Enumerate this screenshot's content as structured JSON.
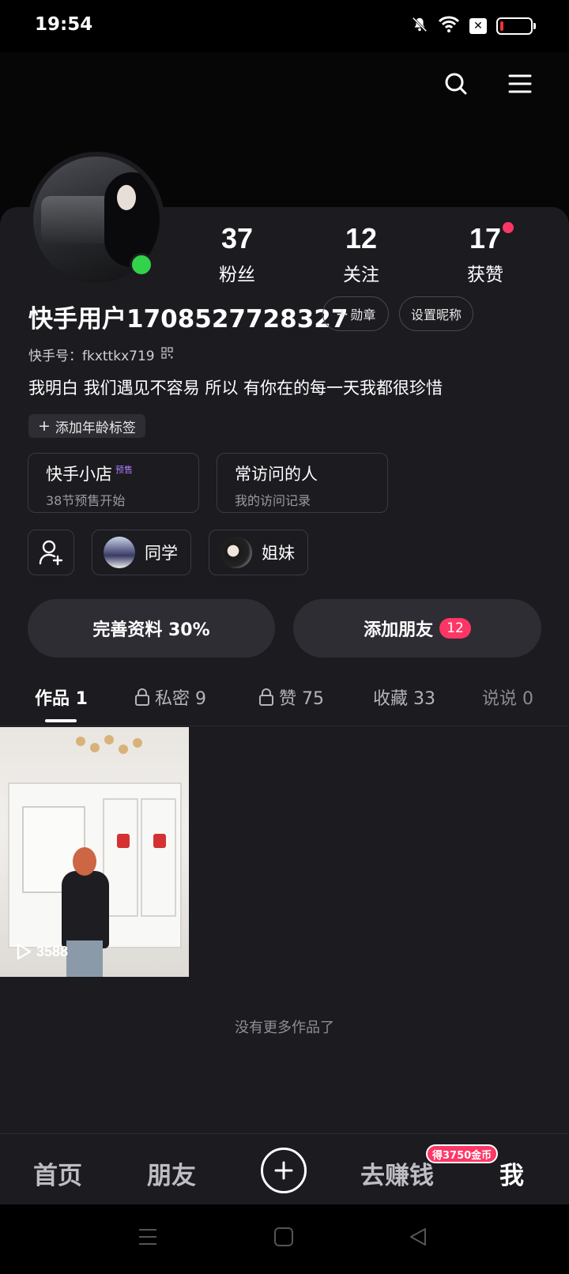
{
  "status_bar": {
    "time": "19:54",
    "icons": [
      "bell-off-icon",
      "wifi-icon",
      "x-box-icon",
      "battery-low-icon"
    ]
  },
  "header": {
    "actions": [
      "search-icon",
      "menu-icon"
    ]
  },
  "profile": {
    "username": "快手用户1708527728327",
    "kuaishou_id": "快手号：fkxttkx719",
    "bio": "我明白 我们遇见不容易 所以 有你在的每一天我都很珍惜",
    "age_tag": "添加年龄标签",
    "badge_button": "勋章",
    "nickname_button": "设置昵称",
    "online": true
  },
  "stats": [
    {
      "value": "37",
      "label": "粉丝"
    },
    {
      "value": "12",
      "label": "关注"
    },
    {
      "value": "17",
      "label": "获赞"
    }
  ],
  "cards": [
    {
      "title": "快手小店",
      "badge": "预售",
      "subtitle": "38节预售开始"
    },
    {
      "title": "常访问的人",
      "badge": "",
      "subtitle": "我的访问记录"
    }
  ],
  "chips": [
    {
      "label": "同学"
    },
    {
      "label": "姐妹"
    }
  ],
  "buttons": {
    "complete_profile": "完善资料 30%",
    "add_friend": "添加朋友",
    "add_friend_count": "12"
  },
  "tabs": [
    {
      "label": "作品 1",
      "locked": false
    },
    {
      "label": "私密 9",
      "locked": true
    },
    {
      "label": "赞 75",
      "locked": true
    },
    {
      "label": "收藏 33",
      "locked": false
    },
    {
      "label": "说说 0",
      "locked": false
    }
  ],
  "works": [
    {
      "play_count": "3588"
    }
  ],
  "no_more_text": "没有更多作品了",
  "bottom_nav": {
    "items": [
      "首页",
      "朋友",
      "去赚钱",
      "我"
    ],
    "coin_badge": "得3750金币",
    "active": "我"
  },
  "colors": {
    "background": "#1b1b20",
    "accent": "#fe3666",
    "online": "#32d24a",
    "presale_badge": "#b07cff"
  }
}
